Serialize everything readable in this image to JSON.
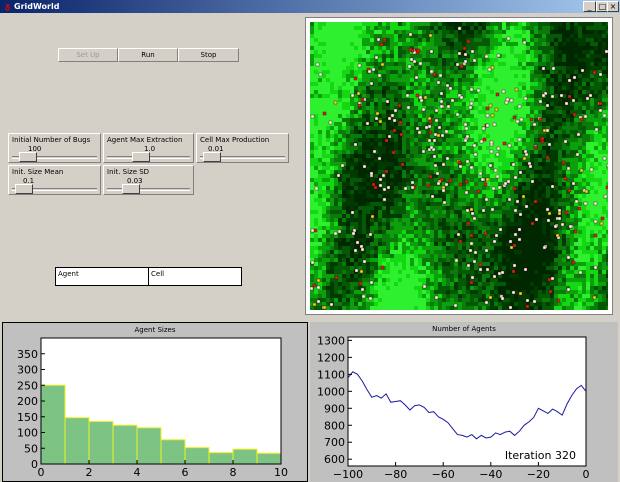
{
  "window": {
    "title": "GridWorld",
    "icon": "app-icon",
    "minimize": "_",
    "maximize": "□",
    "close": "×"
  },
  "controls": {
    "setup_label": "Set Up",
    "run_label": "Run",
    "stop_label": "Stop"
  },
  "sliders": [
    {
      "label": "Initial Number of Bugs",
      "value": "100",
      "level": 0.1
    },
    {
      "label": "Agent Max Extraction",
      "value": "1.0",
      "level": 0.38
    },
    {
      "label": "Cell Max Production",
      "value": "0.01",
      "level": 0.05
    },
    {
      "label": "Init. Size Mean",
      "value": "0.1",
      "level": 0.05
    },
    {
      "label": "Init. Size SD",
      "value": "0.03",
      "level": 0.23
    }
  ],
  "probes": {
    "agent_label": "Agent",
    "cell_label": "Cell"
  },
  "colors": {
    "grass_dark": "#013a01",
    "grass_mid": "#0a7a0a",
    "grass_bright": "#14d814",
    "bug_white": "#ffffff",
    "bug_red": "#e0201a",
    "bug_yellow": "#f0e020",
    "hist_bar": "#7dc383",
    "hist_edge": "#f0f020",
    "line": "#1a1aa0"
  },
  "chart_data": [
    {
      "type": "bar",
      "title": "Agent Sizes",
      "bin_edges": [
        0,
        1,
        2,
        3,
        4,
        5,
        6,
        7,
        8,
        9,
        10
      ],
      "values": [
        250,
        147,
        135,
        123,
        115,
        77,
        52,
        36,
        47,
        34
      ],
      "xlim": [
        0,
        10
      ],
      "ylim": [
        0,
        400
      ],
      "xticks": [
        0,
        2,
        4,
        6,
        8,
        10
      ],
      "yticks": [
        0,
        50,
        100,
        150,
        200,
        250,
        300,
        350
      ],
      "xlabel": "",
      "ylabel": ""
    },
    {
      "type": "line",
      "title": "Number of Agents",
      "xlim": [
        -100,
        0
      ],
      "ylim": [
        560,
        1320
      ],
      "xticks": [
        -100,
        -80,
        -60,
        -40,
        -20,
        0
      ],
      "yticks": [
        600,
        700,
        800,
        900,
        1000,
        1100,
        1200,
        1300
      ],
      "annotation": "Iteration  320",
      "x": [
        -100,
        -98,
        -96,
        -94,
        -92,
        -90,
        -88,
        -86,
        -84,
        -82,
        -80,
        -78,
        -76,
        -74,
        -72,
        -70,
        -68,
        -66,
        -64,
        -62,
        -60,
        -58,
        -56,
        -54,
        -52,
        -50,
        -48,
        -46,
        -44,
        -42,
        -40,
        -38,
        -36,
        -34,
        -32,
        -30,
        -28,
        -26,
        -24,
        -22,
        -20,
        -18,
        -16,
        -14,
        -12,
        -10,
        -8,
        -6,
        -4,
        -2,
        0
      ],
      "y": [
        1080,
        1115,
        1100,
        1060,
        1010,
        965,
        975,
        960,
        985,
        935,
        940,
        945,
        920,
        890,
        915,
        920,
        905,
        875,
        880,
        850,
        835,
        815,
        780,
        745,
        740,
        730,
        745,
        720,
        740,
        725,
        730,
        755,
        745,
        760,
        765,
        740,
        765,
        800,
        820,
        845,
        900,
        885,
        870,
        895,
        880,
        860,
        925,
        975,
        1015,
        1035,
        1000
      ]
    }
  ]
}
